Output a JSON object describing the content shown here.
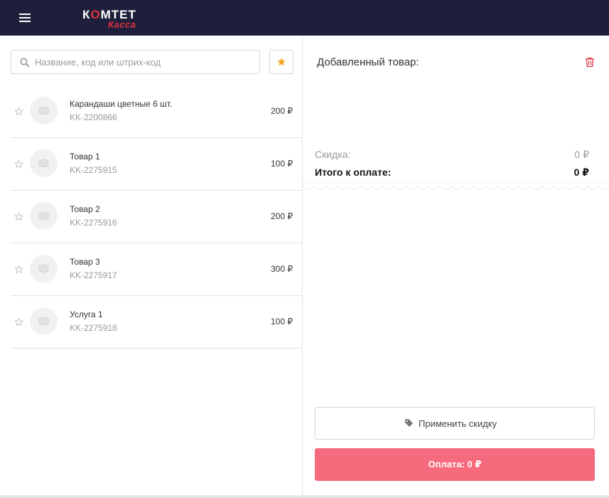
{
  "header": {
    "logo_brand_1": "К",
    "logo_brand_o": "О",
    "logo_brand_2": "МТЕТ",
    "logo_sub": "Касса"
  },
  "search": {
    "placeholder": "Название, код или штрих-код",
    "value": ""
  },
  "products": [
    {
      "name": "Карандаши цветные 6 шт.",
      "code": "KK-2200866",
      "price": "200 ₽"
    },
    {
      "name": "Товар 1",
      "code": "KK-2275915",
      "price": "100 ₽"
    },
    {
      "name": "Товар 2",
      "code": "KK-2275916",
      "price": "200 ₽"
    },
    {
      "name": "Товар 3",
      "code": "KK-2275917",
      "price": "300 ₽"
    },
    {
      "name": "Услуга 1",
      "code": "KK-2275918",
      "price": "100 ₽"
    }
  ],
  "cart": {
    "title": "Добавленный товар:",
    "discount_label": "Скидка:",
    "discount_value": "0 ₽",
    "total_label": "Итого к оплате:",
    "total_value": "0 ₽",
    "apply_discount": "Применить скидку",
    "pay_label": "Оплата: 0 ₽"
  },
  "colors": {
    "header_bg": "#1e1f3b",
    "accent_red": "#e2323f",
    "pay_button": "#f56a7c",
    "star_fav": "#f5a623"
  }
}
